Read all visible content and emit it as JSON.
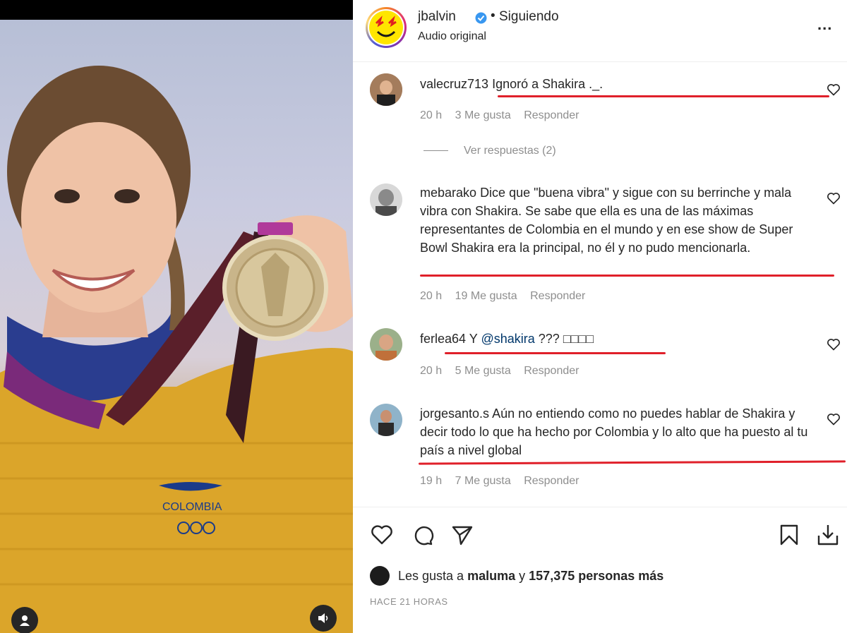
{
  "post": {
    "username": "jbalvin",
    "dot": "•",
    "follow_status": "Siguiendo",
    "audio": "Audio original",
    "more_label": "..."
  },
  "comments": [
    {
      "user": "valecruz713",
      "text": "Ignoró a Shakira ._.",
      "time": "20 h",
      "likes": "3 Me gusta",
      "reply": "Responder"
    },
    {
      "user": "mebarako",
      "text": "Dice que \"buena vibra\" y sigue con su berrinche y mala vibra con Shakira. Se sabe que ella es una de las máximas representantes de Colombia en el mundo y en ese show de Super Bowl Shakira era la principal, no él y no pudo mencionarla.",
      "time": "20 h",
      "likes": "19 Me gusta",
      "reply": "Responder"
    },
    {
      "user": "ferlea64",
      "text_prefix": "Y",
      "mention": "@shakira",
      "text_suffix": "??? □□□□",
      "time": "20 h",
      "likes": "5 Me gusta",
      "reply": "Responder"
    },
    {
      "user": "jorgesanto.s",
      "text": "Aún no entiendo como no puedes hablar de Shakira y decir todo lo que ha hecho por Colombia y lo alto que ha puesto al tu país a nivel global",
      "time": "19 h",
      "likes": "7 Me gusta",
      "reply": "Responder"
    }
  ],
  "view_replies": "Ver respuestas (2)",
  "likes_summary": {
    "prefix": "Les gusta a",
    "user": "maluma",
    "connector": "y",
    "count": "157,375 personas más"
  },
  "timestamp": "HACE 21 HORAS",
  "colors": {
    "underline": "#e0202a",
    "verified": "#3897f0",
    "mention": "#00376b"
  },
  "icons": [
    "heart-icon",
    "comment-icon",
    "share-icon",
    "bookmark-icon",
    "download-icon",
    "user-tag-icon",
    "speaker-icon",
    "verified-icon",
    "more-icon"
  ]
}
